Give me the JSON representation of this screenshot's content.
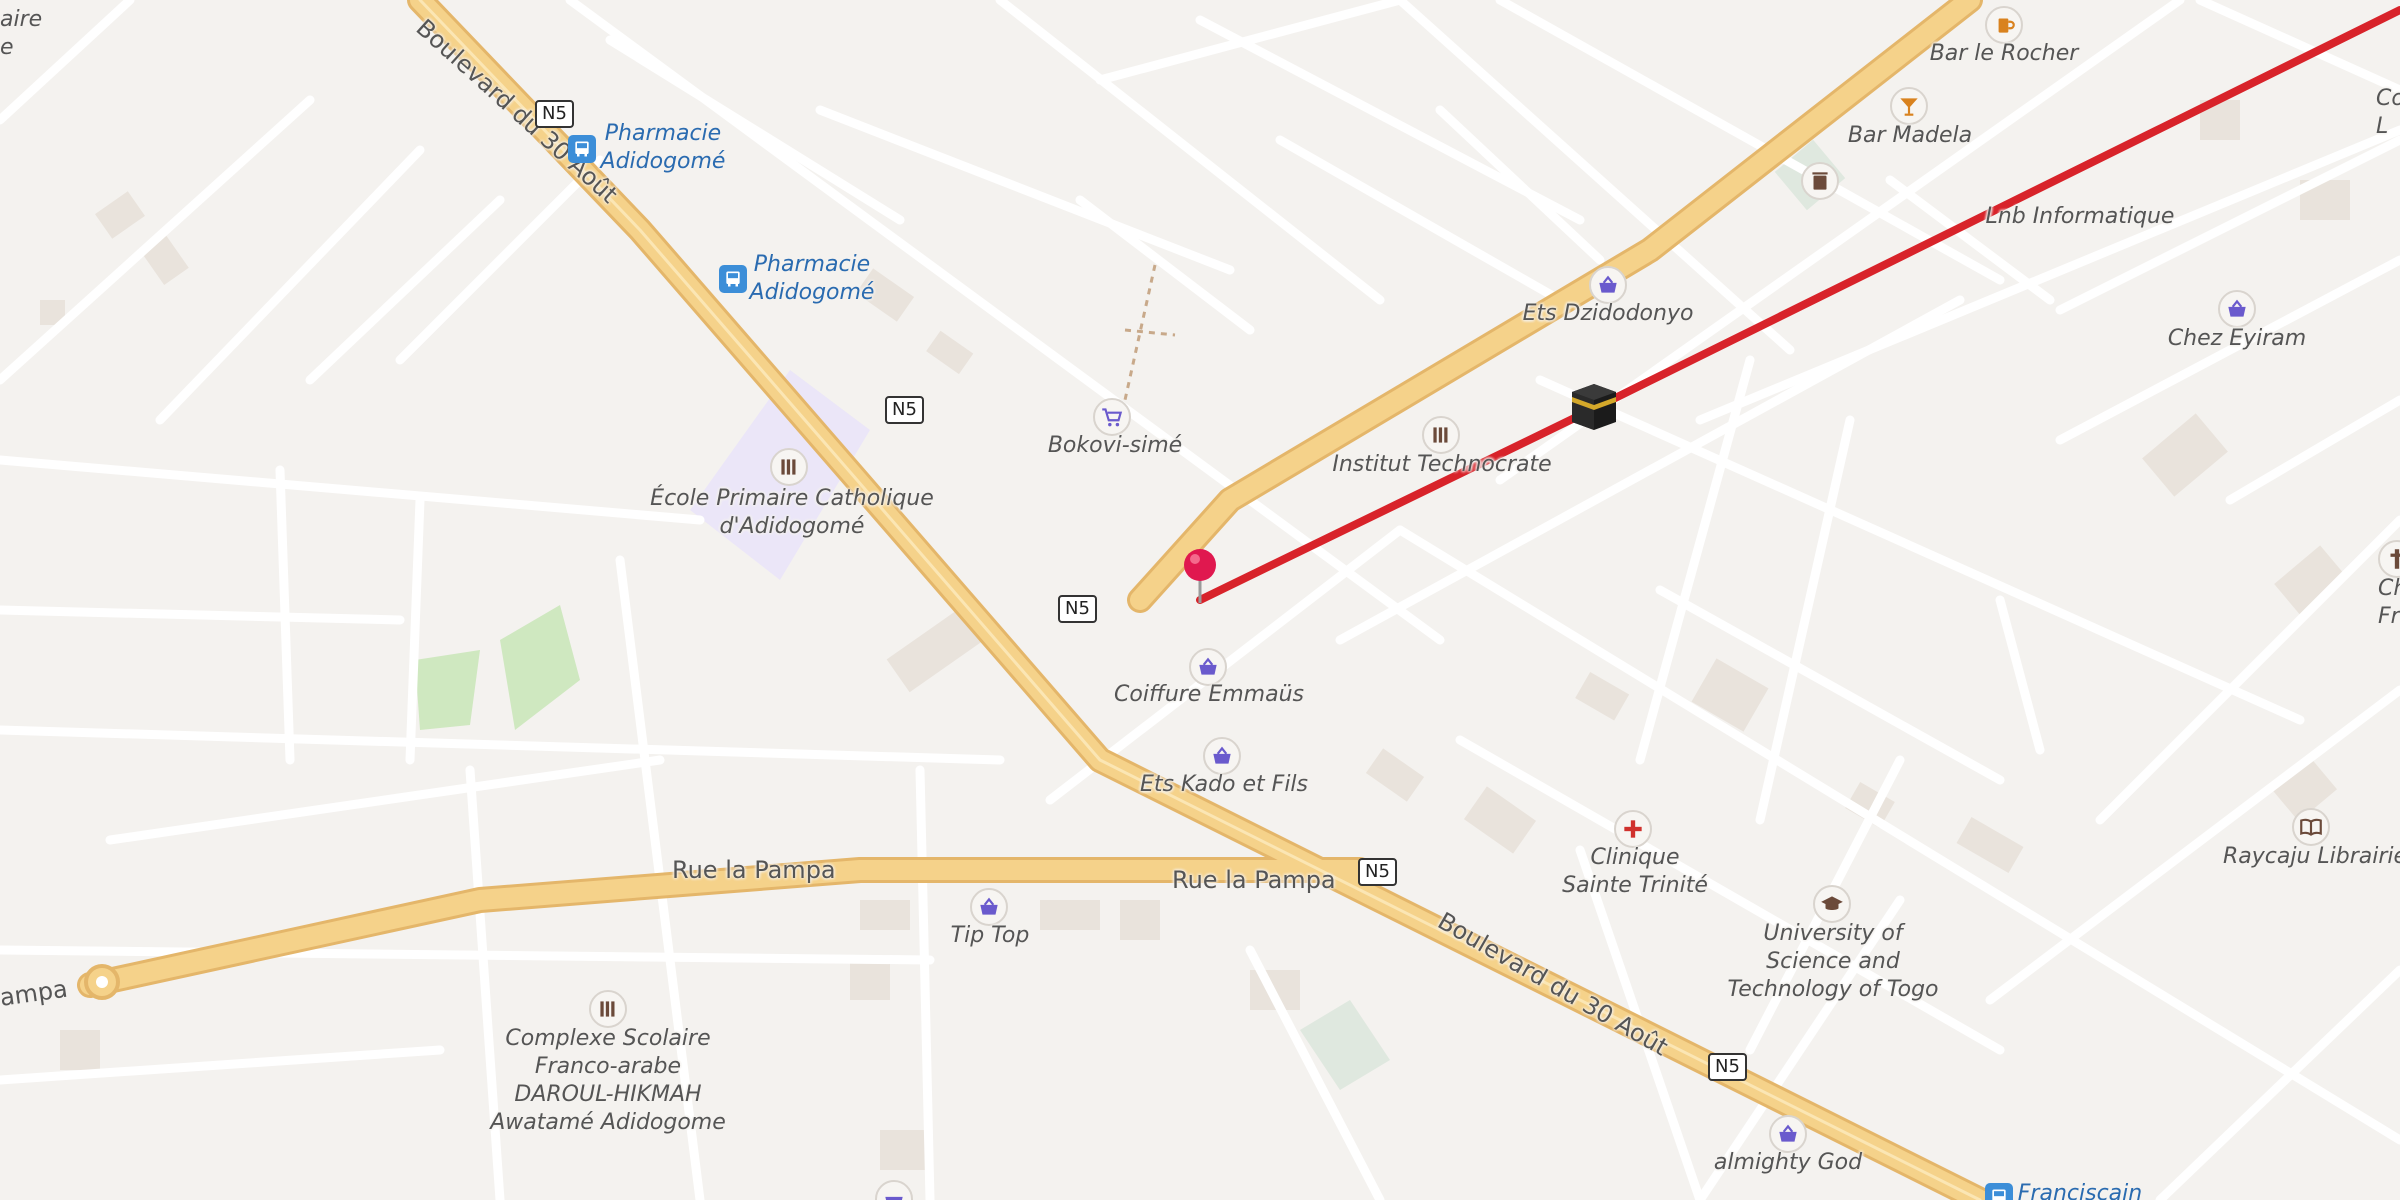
{
  "map": {
    "colors": {
      "background": "#f4f2ef",
      "main_road": "#f5d28a",
      "main_road_casing": "#e4b66a",
      "minor_road": "#ffffff",
      "route_line": "#d8232a",
      "pin": "#e0184f",
      "park": "#cfe8c0",
      "school_area": "#ebe6f8"
    },
    "marker": {
      "name": "location-pin-icon"
    },
    "destination": {
      "name": "kaaba-icon"
    },
    "streets": [
      {
        "id": "bd30-top",
        "label": "Boulevard du 30 Août"
      },
      {
        "id": "bd30-bottom",
        "label": "Boulevard du 30 Août"
      },
      {
        "id": "pampa-1",
        "label": "Rue la Pampa"
      },
      {
        "id": "pampa-2",
        "label": "Rue la Pampa"
      },
      {
        "id": "pampa-3",
        "label": "ampa"
      }
    ],
    "road_shields": [
      "N5",
      "N5",
      "N5",
      "N5",
      "N5"
    ],
    "pois": [
      {
        "label": "Bar le Rocher",
        "icon": "beer-icon",
        "color": "#d9821e"
      },
      {
        "label": "Bar Madela",
        "icon": "cocktail-icon",
        "color": "#d9821e"
      },
      {
        "label": "Lnb Informatique",
        "icon": "",
        "color": "#555555"
      },
      {
        "label": "Ets Dzidodonyo",
        "icon": "shopping-basket-icon",
        "color": "#6a5acd"
      },
      {
        "label": "Chez Eyiram",
        "icon": "shopping-basket-icon",
        "color": "#6a5acd"
      },
      {
        "label": "Institut Technocrate",
        "icon": "school-icon",
        "color": "#6b4a3a"
      },
      {
        "label": "Bokovi-simé",
        "icon": "shopping-cart-icon",
        "color": "#6a5acd"
      },
      {
        "label": "École Primaire Catholique\nd'Adidogomé",
        "icon": "school-icon",
        "color": "#6b4a3a"
      },
      {
        "label": "Pharmacie\nAdidogomé",
        "icon": "bus-stop-icon",
        "color": "#2a6bb0"
      },
      {
        "label": "Pharmacie\nAdidogomé",
        "icon": "bus-stop-icon",
        "color": "#2a6bb0"
      },
      {
        "label": "Coiffure Emmaüs",
        "icon": "shopping-basket-icon",
        "color": "#6a5acd"
      },
      {
        "label": "Ets Kado et Fils",
        "icon": "shopping-basket-icon",
        "color": "#6a5acd"
      },
      {
        "label": "Clinique\nSainte Trinité",
        "icon": "hospital-cross-icon",
        "color": "#d0312d"
      },
      {
        "label": "University of\nScience and\nTechnology of Togo",
        "icon": "graduation-cap-icon",
        "color": "#6b4a3a"
      },
      {
        "label": "Raycaju Librairie",
        "icon": "book-icon",
        "color": "#6b4a3a"
      },
      {
        "label": "Tip Top",
        "icon": "shopping-basket-icon",
        "color": "#6a5acd"
      },
      {
        "label": "Complexe Scolaire\nFranco-arabe\nDAROUL-HIKMAH\nAwatamé Adidogome",
        "icon": "school-icon",
        "color": "#6b4a3a"
      },
      {
        "label": "almighty God",
        "icon": "shopping-basket-icon",
        "color": "#6a5acd"
      },
      {
        "label": "Chapell\nFran",
        "icon": "",
        "color": "#555555"
      },
      {
        "label": "Co\nL",
        "icon": "",
        "color": "#555555"
      },
      {
        "label": "Franciscain",
        "icon": "bus-stop-icon",
        "color": "#2a6bb0"
      },
      {
        "label": "aire\ne",
        "icon": "",
        "color": "#555555"
      }
    ]
  }
}
